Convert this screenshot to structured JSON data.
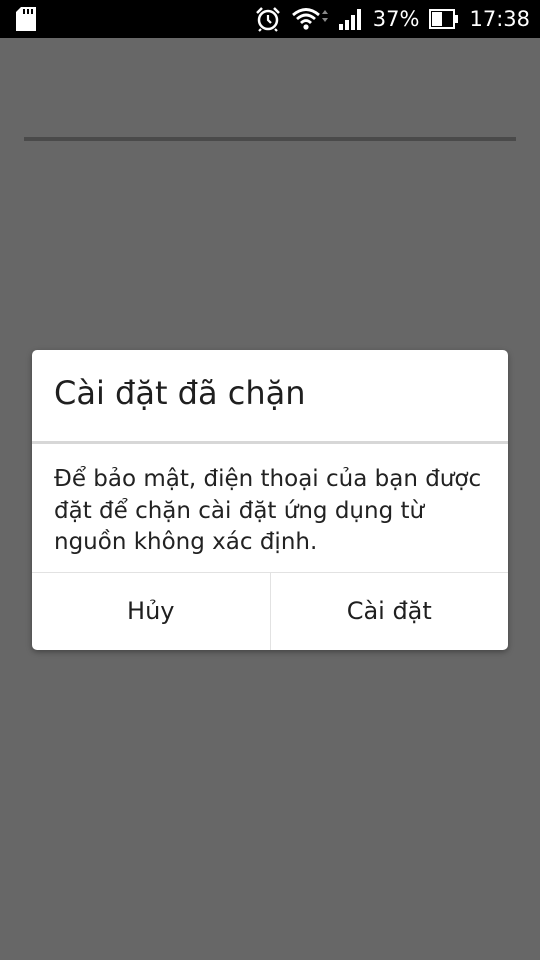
{
  "status_bar": {
    "battery_percent": "37%",
    "time": "17:38",
    "icons": [
      "sd-card-icon",
      "alarm-icon",
      "wifi-icon",
      "signal-icon",
      "battery-icon"
    ]
  },
  "dialog": {
    "title": "Cài đặt đã chặn",
    "message": "Để bảo mật, điện thoại của bạn được đặt để chặn cài đặt ứng dụng từ nguồn không xác định.",
    "buttons": {
      "cancel": "Hủy",
      "install": "Cài đặt"
    }
  },
  "colors": {
    "background_scrim": "#676767",
    "status_bar": "#000000",
    "dialog_bg": "#ffffff"
  }
}
